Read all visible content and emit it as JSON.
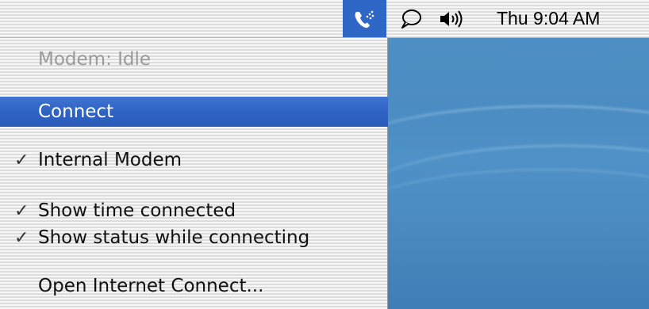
{
  "menubar": {
    "modem_icon": "phone-modem-icon",
    "ichat_icon": "speech-bubble-icon",
    "volume_icon": "speaker-volume-icon",
    "clock": "Thu 9:04 AM"
  },
  "menu": {
    "status": "Modem: Idle",
    "connect": "Connect",
    "internal_modem": "Internal Modem",
    "show_time": "Show time connected",
    "show_status": "Show status while connecting",
    "open_internet_connect": "Open Internet Connect...",
    "checkmark": "✓",
    "highlight_color": "#2f63c4"
  }
}
